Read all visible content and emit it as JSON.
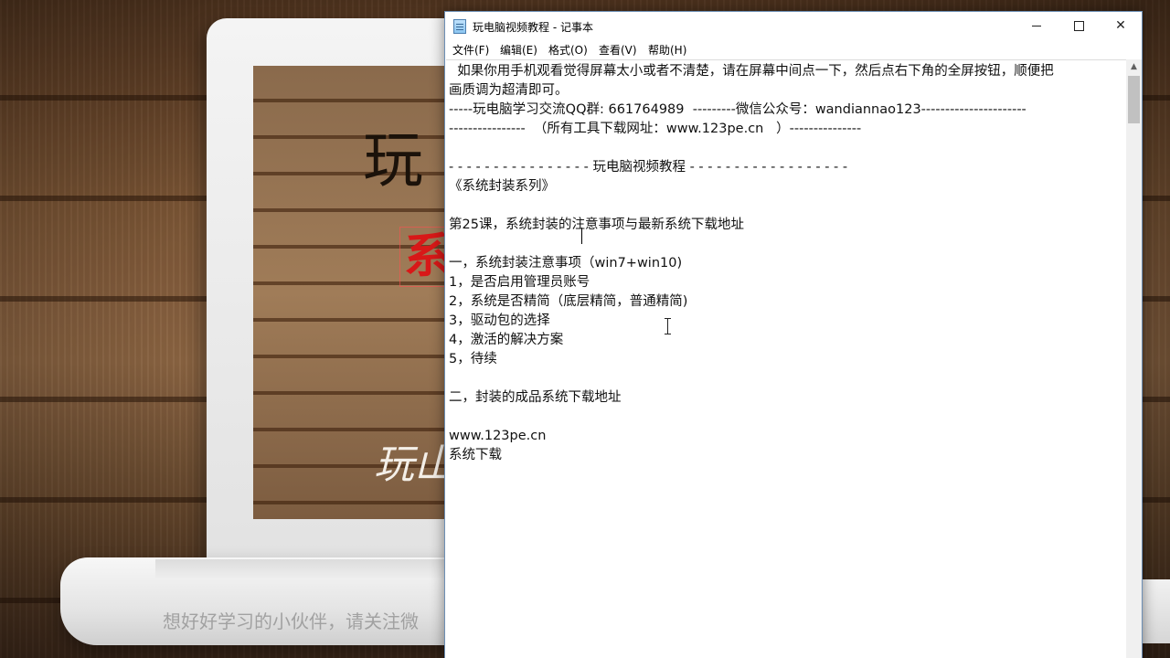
{
  "background": {
    "glyph_1": "玩",
    "glyph_2": "系",
    "glyph_3": "玩山",
    "subtitle": "想好好学习的小伙伴，请关注微"
  },
  "window": {
    "title": "玩电脑视频教程 - 记事本",
    "controls": {
      "minimize": "minimize-icon",
      "maximize": "maximize-icon",
      "close": "✕"
    }
  },
  "menu": [
    "文件(F)",
    "编辑(E)",
    "格式(O)",
    "查看(V)",
    "帮助(H)"
  ],
  "content": {
    "lines": [
      "  如果你用手机观看觉得屏幕太小或者不清楚，请在屏幕中间点一下，然后点右下角的全屏按钮，顺便把",
      "画质调为超清即可。",
      "-----玩电脑学习交流QQ群: 661764989  ---------微信公众号：wandiannao123----------------------",
      "----------------  （所有工具下载网址：www.123pe.cn   ）---------------",
      "",
      "- - - - - - - - - - - - - - - - 玩电脑视频教程 - - - - - - - - - - - - - - - - - -",
      "《系统封装系列》",
      "",
      "第25课，系统封装的注意事项与最新系统下载地址",
      "",
      "一，系统封装注意事项（win7+win10)",
      "1，是否启用管理员账号",
      "2，系统是否精简（底层精简，普通精简)",
      "3，驱动包的选择",
      "4，激活的解决方案",
      "5，待续",
      "",
      "二，封装的成品系统下载地址",
      "",
      "www.123pe.cn",
      "系统下载"
    ]
  }
}
